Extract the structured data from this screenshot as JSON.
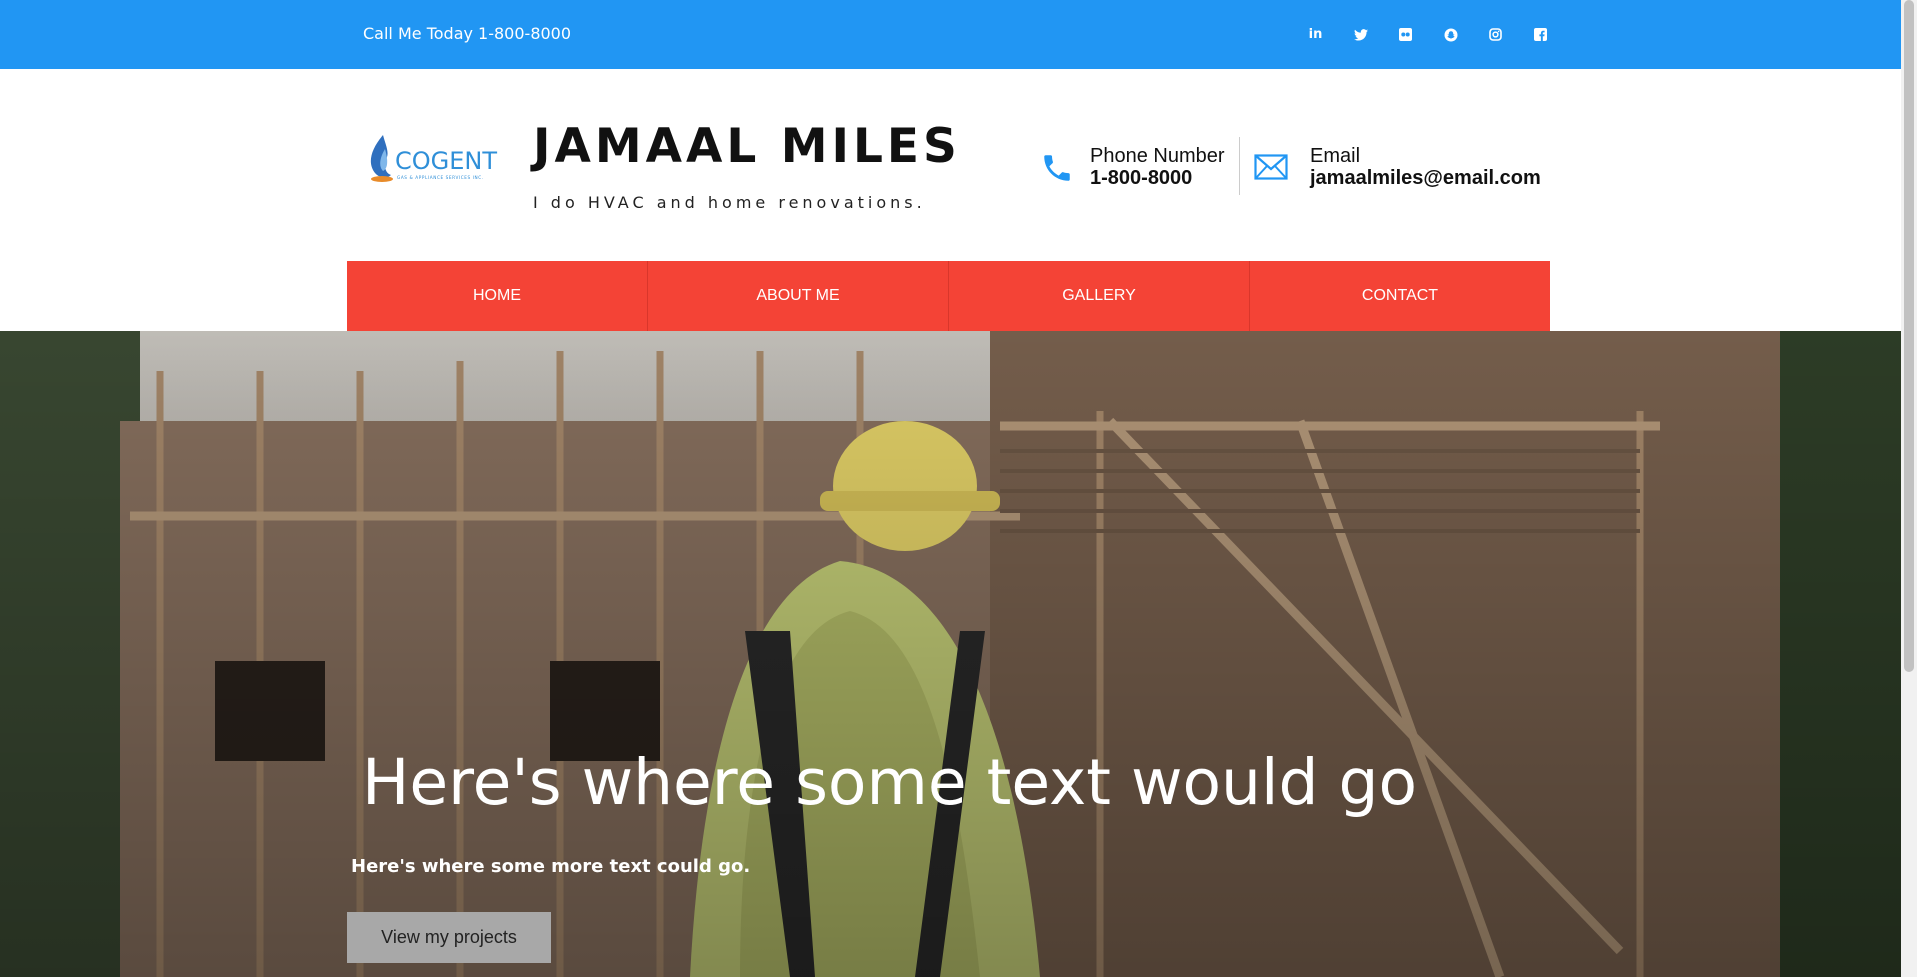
{
  "topbar": {
    "call_text": "Call Me Today 1-800-8000",
    "socials": [
      {
        "icon": "linkedin-icon",
        "glyph": "in"
      },
      {
        "icon": "twitter-icon",
        "glyph": "🐦"
      },
      {
        "icon": "flickr-icon",
        "glyph": "••"
      },
      {
        "icon": "snapchat-icon",
        "glyph": "◉"
      },
      {
        "icon": "instagram-icon",
        "glyph": "◎"
      },
      {
        "icon": "facebook-icon",
        "glyph": "f"
      }
    ],
    "color": "#2196f3"
  },
  "brand": {
    "title": "JAMAAL MILES",
    "tagline": "I do HVAC and home renovations.",
    "logo_text": "COGENT",
    "logo_subtext": "GAS & APPLIANCE SERVICES INC."
  },
  "contact": {
    "phone_label": "Phone Number",
    "phone_value": "1-800-8000",
    "email_label": "Email",
    "email_value": "jamaalmiles@email.com",
    "accent": "#2196f3"
  },
  "nav": {
    "items": [
      "HOME",
      "ABOUT ME",
      "GALLERY",
      "CONTACT"
    ],
    "color": "#f44336"
  },
  "hero": {
    "title": "Here's where some text would go",
    "subtitle": "Here's where some more text could go.",
    "button_label": "View my projects"
  }
}
